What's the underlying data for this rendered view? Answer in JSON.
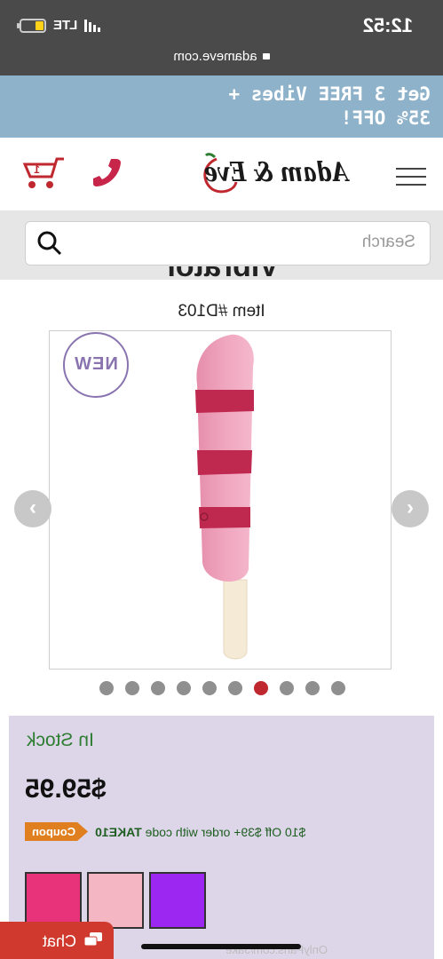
{
  "status_bar": {
    "time": "12:52",
    "network": "LTE",
    "url": "adameve.com"
  },
  "promo": {
    "line1": "Get 3 FREE Vibes +",
    "line2": "35% OFF!"
  },
  "header": {
    "logo_text": "Adam & Eve",
    "icons": [
      "menu-icon",
      "phone-icon",
      "cart-icon"
    ]
  },
  "search": {
    "placeholder": "Search"
  },
  "product": {
    "title_fragment": "Vibrator",
    "item_number": "Item #D103",
    "badge": "NEW",
    "carousel_total": 10,
    "carousel_active_index": 7
  },
  "buy_box": {
    "stock_status": "In Stock",
    "price": "$59.95",
    "coupon_tag": "Coupon",
    "coupon_text": "$10 Off $39+ order with code",
    "coupon_code": "TAKE10",
    "swatch_colors": [
      "#e8337a",
      "#f4b6c2",
      "#9b27f0"
    ]
  },
  "chat": {
    "label": "Chat"
  },
  "watermark": "OnlyFans.com/Jake",
  "colors": {
    "promo_bg": "#8fb2cb",
    "brand_red": "#c0282f",
    "panel_bg": "#ddd6e9",
    "stock_green": "#2e7d32",
    "coupon_orange": "#e07f1f"
  }
}
